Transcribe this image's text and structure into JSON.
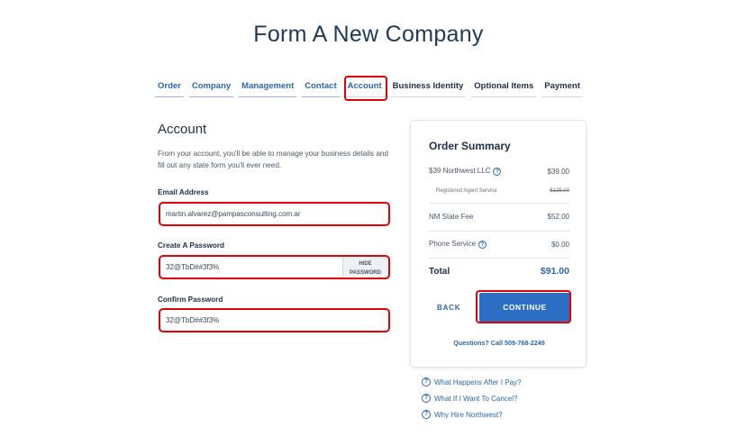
{
  "page_title": "Form A New Company",
  "steps": [
    {
      "label": "Order"
    },
    {
      "label": "Company"
    },
    {
      "label": "Management"
    },
    {
      "label": "Contact"
    },
    {
      "label": "Account"
    },
    {
      "label": "Business Identity"
    },
    {
      "label": "Optional Items"
    },
    {
      "label": "Payment"
    }
  ],
  "account": {
    "title": "Account",
    "intro": "From your account, you'll be able to manage your business details and fill out any state form you'll ever need.",
    "email_label": "Email Address",
    "email_value": "martin.alvarez@pampasconsulting.com.ar",
    "password_label": "Create A Password",
    "password_value": "32@TbD##3f3%",
    "hide_password": "HIDE PASSWORD",
    "confirm_label": "Confirm Password",
    "confirm_value": "32@TbD##3f3%"
  },
  "summary": {
    "title": "Order Summary",
    "items": [
      {
        "label": "$39 Northwest LLC",
        "price": "$39.00"
      },
      {
        "label": "Registered Agent Service",
        "price": "$125.00"
      },
      {
        "label": "NM State Fee",
        "price": "$52.00"
      },
      {
        "label": "Phone Service",
        "price": "$0.00"
      }
    ],
    "total_label": "Total",
    "total_value": "$91.00",
    "back": "BACK",
    "continue": "CONTINUE",
    "questions": "Questions? Call 509-768-2249"
  },
  "faq": [
    "What Happens After I Pay?",
    "What If I Want To Cancel?",
    "Why Hire Northwest?"
  ],
  "colors": {
    "accent": "#2d66ad",
    "highlight": "#e0000a",
    "button": "#2d6ec5"
  }
}
